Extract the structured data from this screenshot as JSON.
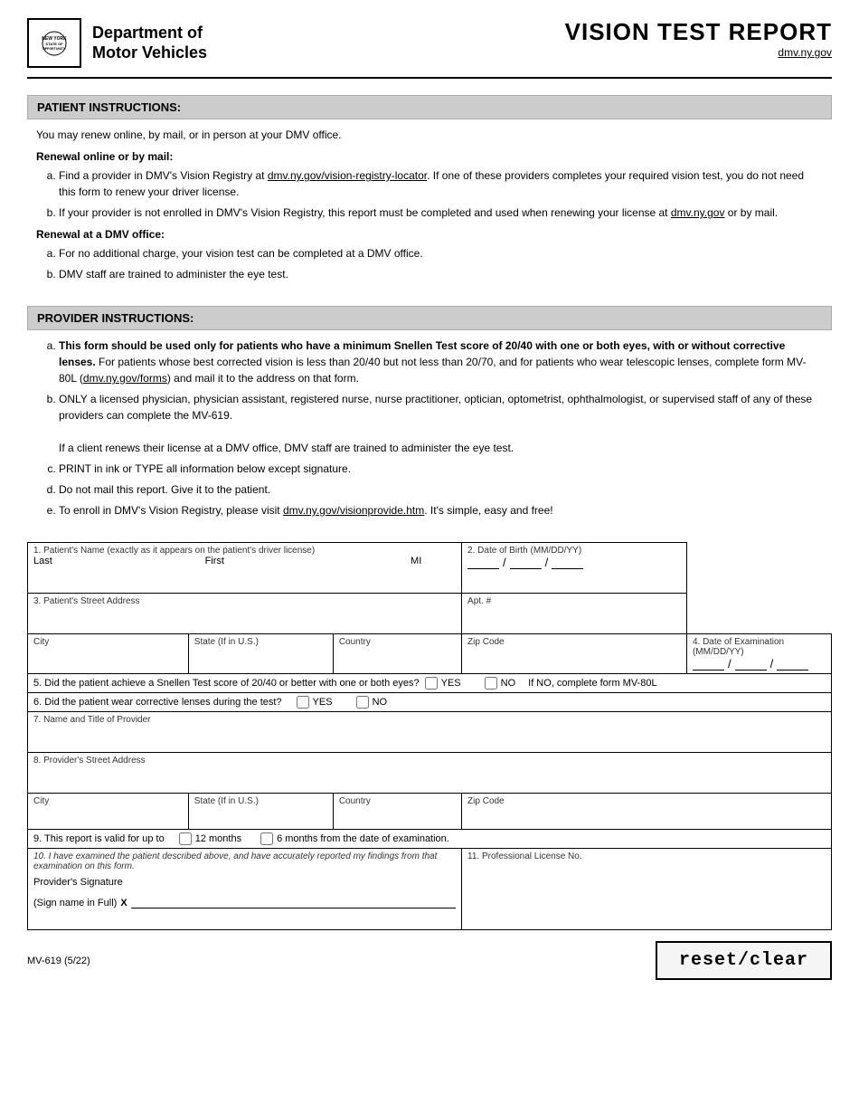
{
  "header": {
    "logo": {
      "new_york": "NEW YORK",
      "state_of": "STATE OF",
      "opportunity": "OPPORTUNITY."
    },
    "dept_line1": "Department of",
    "dept_line2": "Motor Vehicles",
    "report_title": "VISION TEST REPORT",
    "url": "dmv.ny.gov"
  },
  "patient_instructions": {
    "heading": "PATIENT INSTRUCTIONS:",
    "intro": "You may renew online, by mail, or in person at your DMV office.",
    "online_label": "Renewal online or by mail:",
    "online_items": [
      "Find a provider in DMV's Vision Registry at dmv.ny.gov/vision-registry-locator. If one of these providers completes your required vision test, you do not need this form to renew your driver license.",
      "If your provider is not enrolled in DMV's Vision Registry, this report must be completed and used when renewing your license at dmv.ny.gov or by mail."
    ],
    "office_label": "Renewal at a DMV office:",
    "office_items": [
      "For no additional charge, your vision test can be completed at a DMV office.",
      "DMV staff are trained to administer the eye test."
    ]
  },
  "provider_instructions": {
    "heading": "PROVIDER INSTRUCTIONS:",
    "items": [
      {
        "bold_part": "This form should be used only for patients who have a minimum Snellen Test score of 20/40 with one or both eyes, with or without corrective lenses.",
        "normal_part": " For patients whose best corrected vision is less than 20/40 but not less than 20/70, and for patients who wear telescopic lenses, complete form MV-80L (dmv.ny.gov/forms) and mail it to the address on that form."
      },
      {
        "text": "ONLY a licensed physician, physician assistant, registered nurse, nurse practitioner, optician, optometrist, ophthalmologist, or supervised staff of any of these providers can complete the MV-619.\n        If a client renews their license at a DMV office, DMV staff are trained to administer the eye test."
      },
      {
        "text": "PRINT in ink or TYPE all information below except signature."
      },
      {
        "text": "Do not mail this report. Give it to the patient."
      },
      {
        "text": "To enroll in DMV's Vision Registry, please visit dmv.ny.gov/visionprovide.htm. It's simple, easy and free!"
      }
    ]
  },
  "form": {
    "field1_label": "1. Patient's Name (exactly as it appears on the patient's driver license)",
    "field1_last": "Last",
    "field1_first": "First",
    "field1_mi": "MI",
    "field2_label": "2. Date of Birth (MM/DD/YY)",
    "field3_label": "3. Patient's Street Address",
    "field3_apt": "Apt. #",
    "field4_city": "City",
    "field4_state": "State (If in U.S.)",
    "field4_country": "Country",
    "field4_zip": "Zip Code",
    "field4_exam_label": "4. Date of Examination  (MM/DD/YY)",
    "field5_label": "5. Did the patient achieve a Snellen Test score of 20/40 or better with one or both eyes?",
    "field5_yes": "YES",
    "field5_no": "NO",
    "field5_if_no": "If NO, complete form MV-80L",
    "field6_label": "6. Did the patient wear corrective lenses during the test?",
    "field6_yes": "YES",
    "field6_no": "NO",
    "field7_label": "7. Name and Title of Provider",
    "field8_label": "8. Provider's Street Address",
    "field8_city": "City",
    "field8_state": "State (If in U.S.)",
    "field8_country": "Country",
    "field8_zip": "Zip Code",
    "field9_label": "9. This report is valid for up to",
    "field9_12months": "12 months",
    "field9_6months": "6 months from the date of examination.",
    "field10_label": "10. I have examined the patient described above, and have accurately reported my findings from that examination on this form.",
    "field10_sig_label": "Provider's Signature",
    "field10_sign_full": "(Sign name in Full)",
    "field10_x": "X",
    "field11_label": "11. Professional License No.",
    "form_number": "MV-619 (5/22)",
    "reset_clear": "reset/clear"
  }
}
